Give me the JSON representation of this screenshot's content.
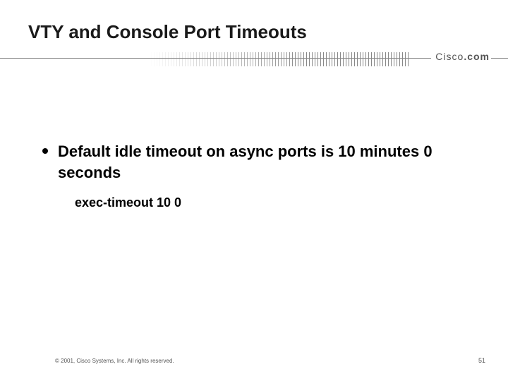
{
  "title": "VTY and Console Port Timeouts",
  "brand": {
    "word": "Cisco",
    "dot": ".com"
  },
  "bullet": "Default idle timeout on async ports is 10 minutes 0 seconds",
  "subline": "exec-timeout 10 0",
  "footer": {
    "copyright": "© 2001, Cisco Systems, Inc. All rights reserved.",
    "page": "51"
  }
}
